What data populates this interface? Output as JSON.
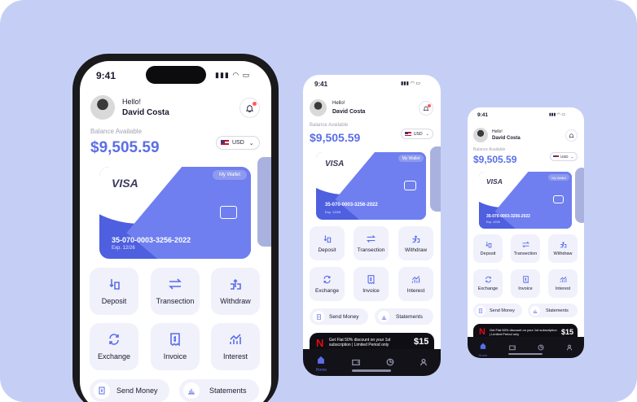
{
  "status_time": "9:41",
  "greeting": "Hello!",
  "user_name": "David Costa",
  "balance_label": "Balance Available",
  "balance": "$9,505.59",
  "currency": "USD",
  "card": {
    "brand": "VISA",
    "tag": "My Wallet",
    "number": "35-070-0003-3256-2022",
    "expiry": "Exp. 12/26"
  },
  "actions": [
    "Deposit",
    "Transection",
    "Withdraw",
    "Exchange",
    "Invoice",
    "Interest"
  ],
  "buttons": {
    "send_money": "Send Money",
    "statements": "Statements"
  },
  "promo": {
    "text": "Get Flat 50% discount on your 1st subscription | Limited Period only",
    "amount": "$15",
    "logo": "N"
  },
  "nav": {
    "home_label": "Home"
  },
  "colors": {
    "accent": "#5b6ee8",
    "card": "#4e5fe0",
    "background": "#c5cff6",
    "nav": "#121218"
  }
}
